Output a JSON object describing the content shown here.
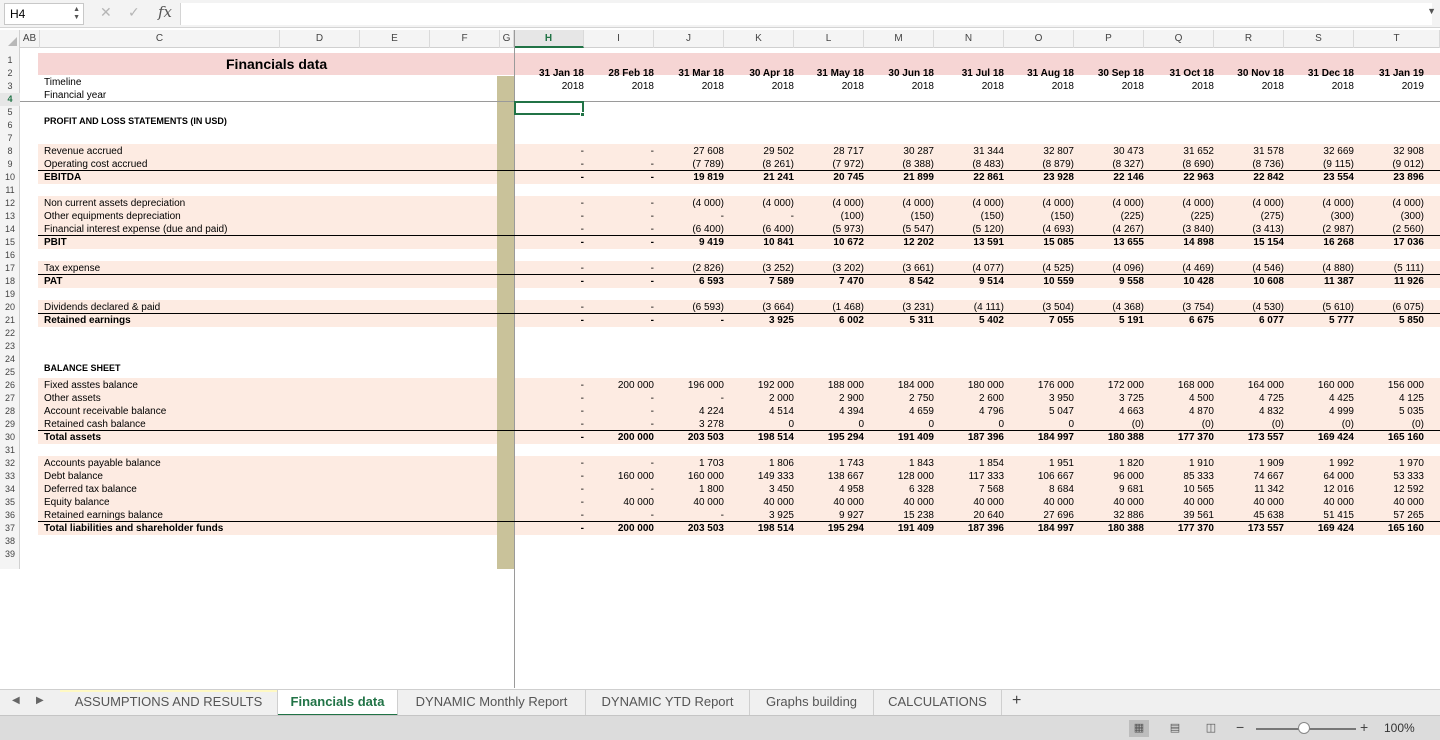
{
  "formula_bar": {
    "name_box": "H4",
    "formula": ""
  },
  "columns": [
    "A",
    "B",
    "C",
    "D",
    "E",
    "F",
    "G",
    "H",
    "I",
    "J",
    "K",
    "L",
    "M",
    "N",
    "O",
    "P",
    "Q",
    "R",
    "S",
    "T"
  ],
  "column_header_ab": "AB",
  "active_column": "H",
  "active_row": "4",
  "rows": [
    "1",
    "2",
    "3",
    "4",
    "5",
    "6",
    "7",
    "8",
    "9",
    "10",
    "11",
    "12",
    "13",
    "14",
    "15",
    "16",
    "17",
    "18",
    "19",
    "20",
    "21",
    "22",
    "23",
    "24",
    "25",
    "26",
    "27",
    "28",
    "29",
    "30",
    "31",
    "32",
    "33",
    "34",
    "35",
    "36",
    "37",
    "38",
    "39"
  ],
  "page_title": "Financials data",
  "timeline_label": "Timeline",
  "financial_year_label": "Financial year",
  "dates": [
    "31 Jan 18",
    "28 Feb 18",
    "31 Mar 18",
    "30 Apr 18",
    "31 May 18",
    "30 Jun 18",
    "31 Jul 18",
    "31 Aug 18",
    "30 Sep 18",
    "31 Oct 18",
    "30 Nov 18",
    "31 Dec 18",
    "31 Jan 19"
  ],
  "years": [
    "2018",
    "2018",
    "2018",
    "2018",
    "2018",
    "2018",
    "2018",
    "2018",
    "2018",
    "2018",
    "2018",
    "2018",
    "2019"
  ],
  "sections": {
    "pnl": "PROFIT AND LOSS STATEMENTS (IN USD)",
    "bs": "BALANCE SHEET"
  },
  "line_items": [
    {
      "row": 8,
      "label": "Revenue accrued",
      "bold": false,
      "values": [
        "-",
        "-",
        "27 608",
        "29 502",
        "28 717",
        "30 287",
        "31 344",
        "32 807",
        "30 473",
        "31 652",
        "31 578",
        "32 669",
        "32 908"
      ]
    },
    {
      "row": 9,
      "label": "Operating cost accrued",
      "bold": false,
      "values": [
        "-",
        "-",
        "(7 789)",
        "(8 261)",
        "(7 972)",
        "(8 388)",
        "(8 483)",
        "(8 879)",
        "(8 327)",
        "(8 690)",
        "(8 736)",
        "(9 115)",
        "(9 012)"
      ]
    },
    {
      "row": 10,
      "label": "EBITDA",
      "bold": true,
      "values": [
        "-",
        "-",
        "19 819",
        "21 241",
        "20 745",
        "21 899",
        "22 861",
        "23 928",
        "22 146",
        "22 963",
        "22 842",
        "23 554",
        "23 896"
      ]
    },
    {
      "row": 12,
      "label": "Non current assets depreciation",
      "bold": false,
      "values": [
        "-",
        "-",
        "(4 000)",
        "(4 000)",
        "(4 000)",
        "(4 000)",
        "(4 000)",
        "(4 000)",
        "(4 000)",
        "(4 000)",
        "(4 000)",
        "(4 000)",
        "(4 000)"
      ]
    },
    {
      "row": 13,
      "label": "Other equipments depreciation",
      "bold": false,
      "values": [
        "-",
        "-",
        "-",
        "-",
        "(100)",
        "(150)",
        "(150)",
        "(150)",
        "(225)",
        "(225)",
        "(275)",
        "(300)",
        "(300)"
      ]
    },
    {
      "row": 14,
      "label": "Financial  interest expense (due and paid)",
      "bold": false,
      "values": [
        "-",
        "-",
        "(6 400)",
        "(6 400)",
        "(5 973)",
        "(5 547)",
        "(5 120)",
        "(4 693)",
        "(4 267)",
        "(3 840)",
        "(3 413)",
        "(2 987)",
        "(2 560)"
      ]
    },
    {
      "row": 15,
      "label": "PBIT",
      "bold": true,
      "values": [
        "-",
        "-",
        "9 419",
        "10 841",
        "10 672",
        "12 202",
        "13 591",
        "15 085",
        "13 655",
        "14 898",
        "15 154",
        "16 268",
        "17 036"
      ]
    },
    {
      "row": 17,
      "label": "Tax expense",
      "bold": false,
      "values": [
        "-",
        "-",
        "(2 826)",
        "(3 252)",
        "(3 202)",
        "(3 661)",
        "(4 077)",
        "(4 525)",
        "(4 096)",
        "(4 469)",
        "(4 546)",
        "(4 880)",
        "(5 111)"
      ]
    },
    {
      "row": 18,
      "label": "PAT",
      "bold": true,
      "values": [
        "-",
        "-",
        "6 593",
        "7 589",
        "7 470",
        "8 542",
        "9 514",
        "10 559",
        "9 558",
        "10 428",
        "10 608",
        "11 387",
        "11 926"
      ]
    },
    {
      "row": 20,
      "label": "Dividends declared & paid",
      "bold": false,
      "values": [
        "-",
        "-",
        "(6 593)",
        "(3 664)",
        "(1 468)",
        "(3 231)",
        "(4 111)",
        "(3 504)",
        "(4 368)",
        "(3 754)",
        "(4 530)",
        "(5 610)",
        "(6 075)"
      ]
    },
    {
      "row": 21,
      "label": "Retained earnings",
      "bold": true,
      "values": [
        "-",
        "-",
        "-",
        "3 925",
        "6 002",
        "5 311",
        "5 402",
        "7 055",
        "5 191",
        "6 675",
        "6 077",
        "5 777",
        "5 850"
      ]
    },
    {
      "row": 26,
      "label": "Fixed asstes balance",
      "bold": false,
      "values": [
        "-",
        "200 000",
        "196 000",
        "192 000",
        "188 000",
        "184 000",
        "180 000",
        "176 000",
        "172 000",
        "168 000",
        "164 000",
        "160 000",
        "156 000"
      ]
    },
    {
      "row": 27,
      "label": "Other assets",
      "bold": false,
      "values": [
        "-",
        "-",
        "-",
        "2 000",
        "2 900",
        "2 750",
        "2 600",
        "3 950",
        "3 725",
        "4 500",
        "4 725",
        "4 425",
        "4 125"
      ]
    },
    {
      "row": 28,
      "label": "Account receivable balance",
      "bold": false,
      "values": [
        "-",
        "-",
        "4 224",
        "4 514",
        "4 394",
        "4 659",
        "4 796",
        "5 047",
        "4 663",
        "4 870",
        "4 832",
        "4 999",
        "5 035"
      ]
    },
    {
      "row": 29,
      "label": "Retained cash balance",
      "bold": false,
      "values": [
        "-",
        "-",
        "3 278",
        "0",
        "0",
        "0",
        "0",
        "0",
        "(0)",
        "(0)",
        "(0)",
        "(0)",
        "(0)"
      ]
    },
    {
      "row": 30,
      "label": "Total assets",
      "bold": true,
      "values": [
        "-",
        "200 000",
        "203 503",
        "198 514",
        "195 294",
        "191 409",
        "187 396",
        "184 997",
        "180 388",
        "177 370",
        "173 557",
        "169 424",
        "165 160"
      ]
    },
    {
      "row": 32,
      "label": "Accounts payable balance",
      "bold": false,
      "values": [
        "-",
        "-",
        "1 703",
        "1 806",
        "1 743",
        "1 843",
        "1 854",
        "1 951",
        "1 820",
        "1 910",
        "1 909",
        "1 992",
        "1 970"
      ]
    },
    {
      "row": 33,
      "label": "Debt balance",
      "bold": false,
      "values": [
        "-",
        "160 000",
        "160 000",
        "149 333",
        "138 667",
        "128 000",
        "117 333",
        "106 667",
        "96 000",
        "85 333",
        "74 667",
        "64 000",
        "53 333"
      ]
    },
    {
      "row": 34,
      "label": "Deferred tax balance",
      "bold": false,
      "values": [
        "-",
        "-",
        "1 800",
        "3 450",
        "4 958",
        "6 328",
        "7 568",
        "8 684",
        "9 681",
        "10 565",
        "11 342",
        "12 016",
        "12 592"
      ]
    },
    {
      "row": 35,
      "label": "Equity balance",
      "bold": false,
      "values": [
        "-",
        "40 000",
        "40 000",
        "40 000",
        "40 000",
        "40 000",
        "40 000",
        "40 000",
        "40 000",
        "40 000",
        "40 000",
        "40 000",
        "40 000"
      ]
    },
    {
      "row": 36,
      "label": "Retained earnings balance",
      "bold": false,
      "values": [
        "-",
        "-",
        "-",
        "3 925",
        "9 927",
        "15 238",
        "20 640",
        "27 696",
        "32 886",
        "39 561",
        "45 638",
        "51 415",
        "57 265"
      ]
    },
    {
      "row": 37,
      "label": "Total liabilities and shareholder funds",
      "bold": true,
      "values": [
        "-",
        "200 000",
        "203 503",
        "198 514",
        "195 294",
        "191 409",
        "187 396",
        "184 997",
        "180 388",
        "177 370",
        "173 557",
        "169 424",
        "165 160"
      ]
    }
  ],
  "sheet_tabs": [
    {
      "label": "ASSUMPTIONS AND RESULTS",
      "active": false
    },
    {
      "label": "Financials data",
      "active": true
    },
    {
      "label": "DYNAMIC Monthly Report",
      "active": false
    },
    {
      "label": "DYNAMIC YTD Report",
      "active": false
    },
    {
      "label": "Graphs building",
      "active": false
    },
    {
      "label": "CALCULATIONS",
      "active": false
    }
  ],
  "add_sheet_label": "+",
  "status_bar": {
    "zoom_label": "100%",
    "zoom_percent": 100,
    "view": "normal"
  },
  "icons": {
    "cancel": "close-icon",
    "enter": "check-icon",
    "function": "fx-icon",
    "nav_prev": "triangle-left-icon",
    "nav_next": "triangle-right-icon"
  }
}
